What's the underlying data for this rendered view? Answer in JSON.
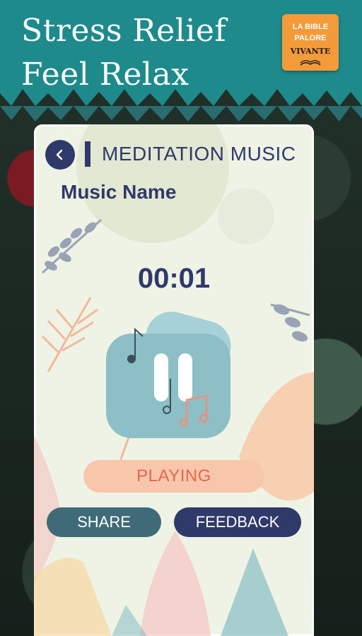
{
  "banner": {
    "headline_line1": "Stress Relief",
    "headline_line2": "Feel Relax",
    "logo": {
      "line1": "LA BIBLE",
      "line2": "PALORE",
      "line3": "VIVANTE"
    }
  },
  "screen": {
    "title": "MEDITATION MUSIC",
    "music_name": "Music Name",
    "elapsed_time": "00:01",
    "status_label": "PLAYING",
    "share_label": "SHARE",
    "feedback_label": "FEEDBACK",
    "back_icon": "chevron-left-icon",
    "player_icon": "pause-icon"
  },
  "colors": {
    "teal_banner": "#1f8a8c",
    "navy": "#2f3a6a",
    "share_button": "#3f6a78",
    "playing_pill": "#f8c7ab",
    "playing_text": "#e06850",
    "logo_orange": "#f39a3b"
  }
}
